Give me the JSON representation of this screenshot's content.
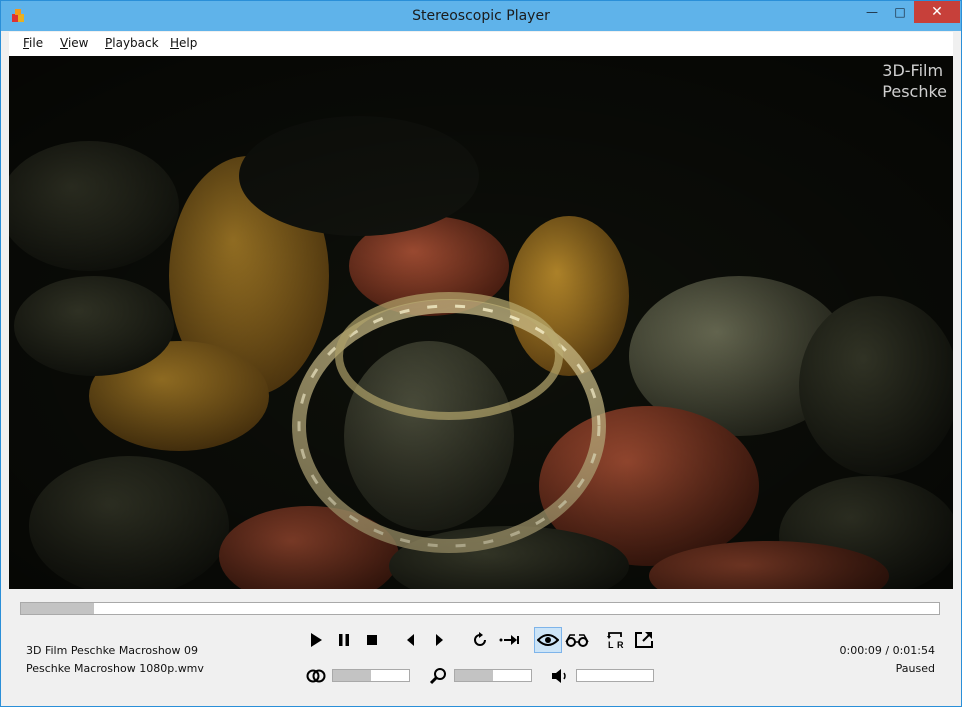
{
  "window": {
    "title": "Stereoscopic Player",
    "min_glyph": "—",
    "max_glyph": "□",
    "close_glyph": "✕"
  },
  "menu": {
    "items": [
      {
        "label": "File"
      },
      {
        "label": "View"
      },
      {
        "label": "Playback"
      },
      {
        "label": "Help"
      }
    ]
  },
  "video": {
    "watermark_line1": "3D-Film",
    "watermark_line2": "Peschke"
  },
  "playback": {
    "progress_fraction": 0.08,
    "info_line1": "3D Film Peschke Macroshow 09",
    "info_line2": "Peschke Macroshow 1080p.wmv",
    "time": "0:00:09 / 0:01:54",
    "status": "Paused"
  },
  "controls": {
    "icons": [
      "play-icon",
      "pause-icon",
      "stop-icon",
      "previous-icon",
      "next-icon",
      "loop-icon",
      "skip-icon",
      "eye-icon",
      "glasses-icon",
      "swap-lr-icon",
      "fullscreen-icon"
    ],
    "active": "eye-icon"
  },
  "sliders": {
    "stereo_level": 0.5,
    "zoom_level": 0.5,
    "volume_level": 0.0
  },
  "colors": {
    "titlebar": "#5fb3ea",
    "close_button": "#c7403a",
    "active_control": "#cce4f7"
  }
}
